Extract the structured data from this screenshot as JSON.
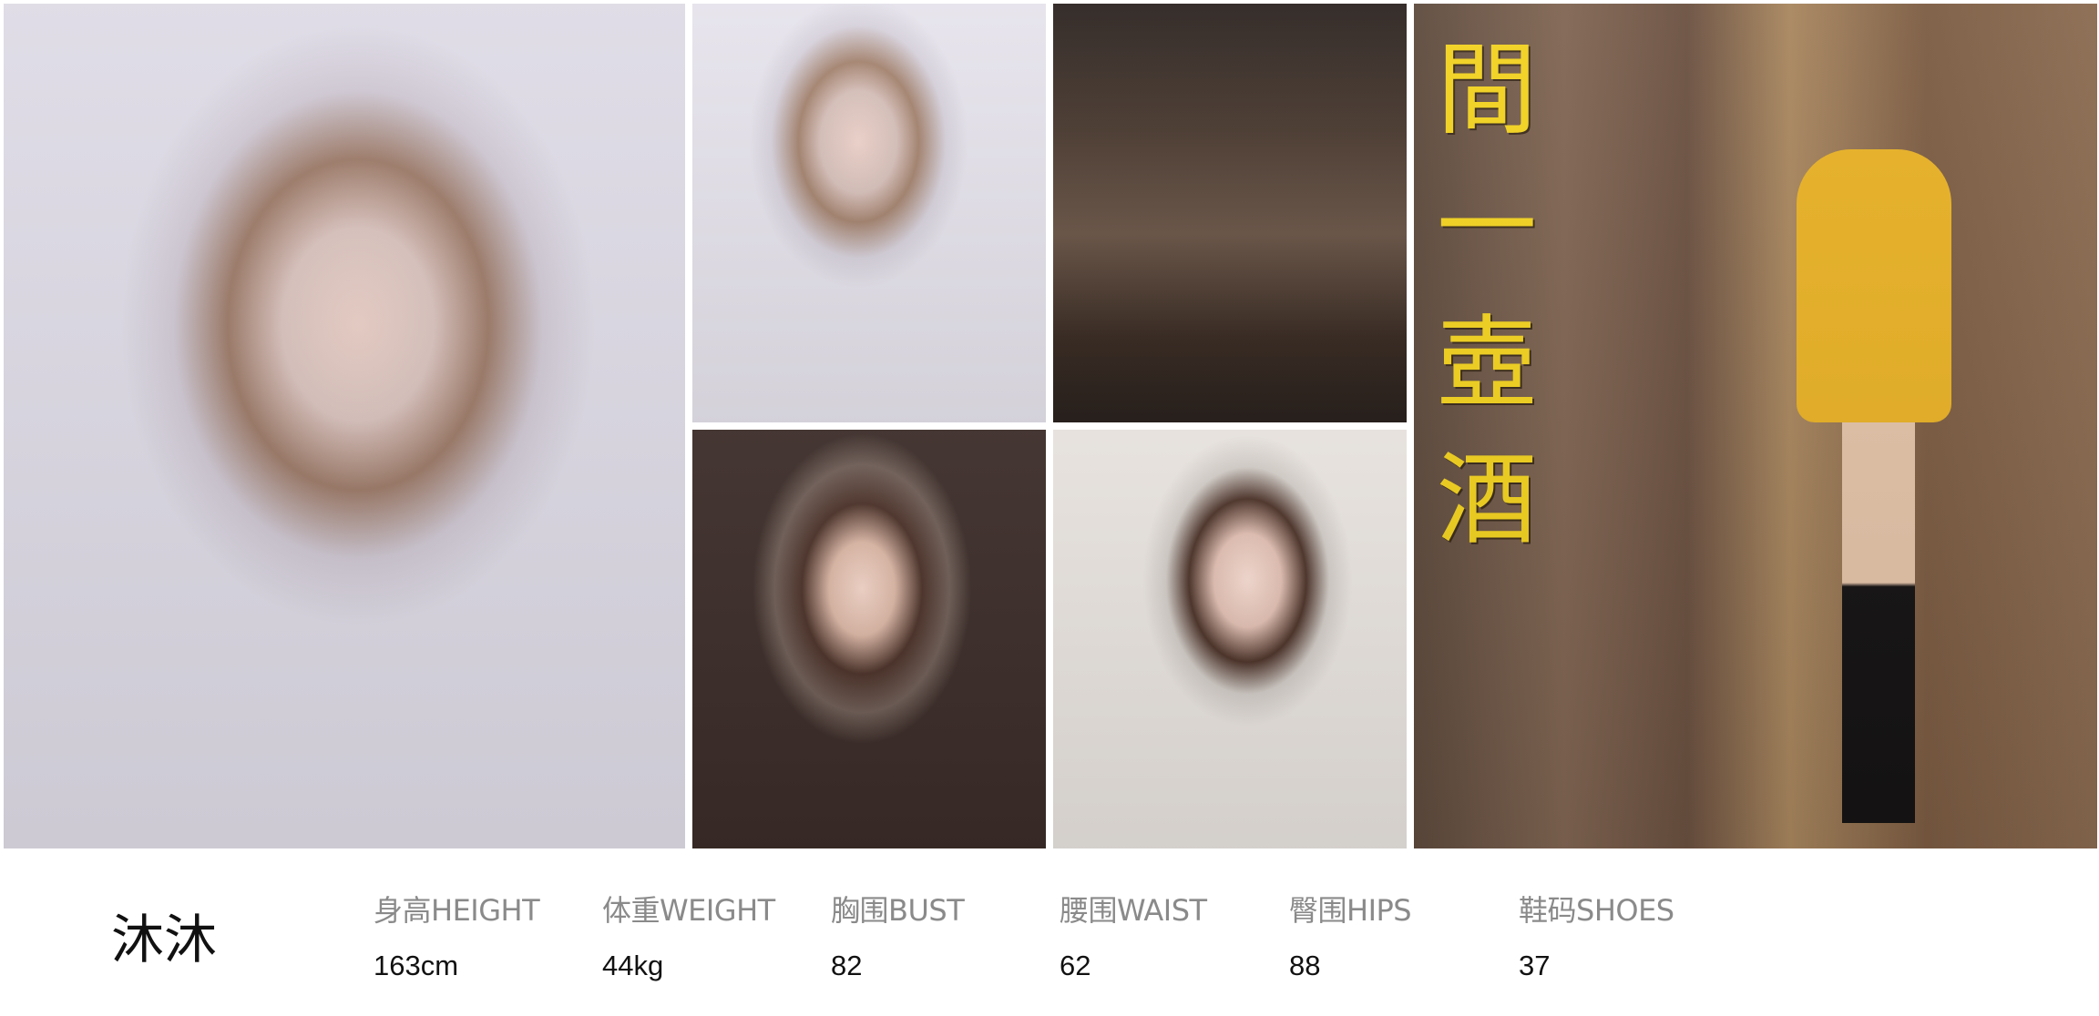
{
  "model": {
    "name": "沐沐"
  },
  "photos": [
    {
      "icon": "portrait-photo"
    },
    {
      "icon": "portrait-photo"
    },
    {
      "icon": "full-body-photo"
    },
    {
      "icon": "portrait-photo"
    },
    {
      "icon": "portrait-photo"
    },
    {
      "icon": "full-body-photo",
      "sign_text": "間一壺酒"
    }
  ],
  "stats": [
    {
      "label": "身高HEIGHT",
      "value": "163cm"
    },
    {
      "label": "体重WEIGHT",
      "value": "44kg"
    },
    {
      "label": "胸围BUST",
      "value": "82"
    },
    {
      "label": "腰围WAIST",
      "value": "62"
    },
    {
      "label": "臀围HIPS",
      "value": "88"
    },
    {
      "label": "鞋码SHOES",
      "value": "37"
    }
  ]
}
